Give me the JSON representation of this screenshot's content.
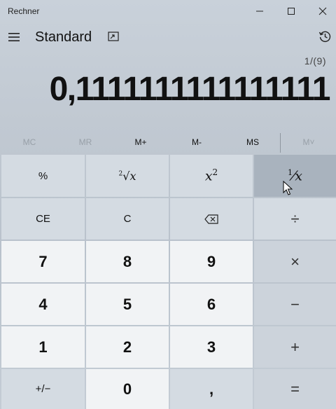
{
  "window": {
    "title": "Rechner"
  },
  "header": {
    "mode": "Standard"
  },
  "display": {
    "expression": "1/(9)",
    "value": "0,1111111111111111"
  },
  "memory": [
    "MC",
    "MR",
    "M+",
    "M-",
    "MS",
    "M˅"
  ],
  "keys": {
    "percent": "%",
    "sqrt_index": "2",
    "sqrt_x": "x",
    "square_base": "x",
    "square_exp": "2",
    "recip_num": "1",
    "recip_den": "x",
    "clear_entry": "CE",
    "clear": "C",
    "divide": "÷",
    "seven": "7",
    "eight": "8",
    "nine": "9",
    "multiply": "×",
    "four": "4",
    "five": "5",
    "six": "6",
    "minus": "−",
    "one": "1",
    "two": "2",
    "three": "3",
    "plus": "+",
    "negate": "+/−",
    "zero": "0",
    "decimal": ",",
    "equals": "="
  },
  "icons": {
    "menu": "hamburger-menu-icon",
    "keep_on_top": "keep-on-top-icon",
    "history": "history-icon",
    "backspace": "backspace-icon",
    "minimize": "minimize-icon",
    "maximize": "maximize-icon",
    "close": "close-icon"
  }
}
